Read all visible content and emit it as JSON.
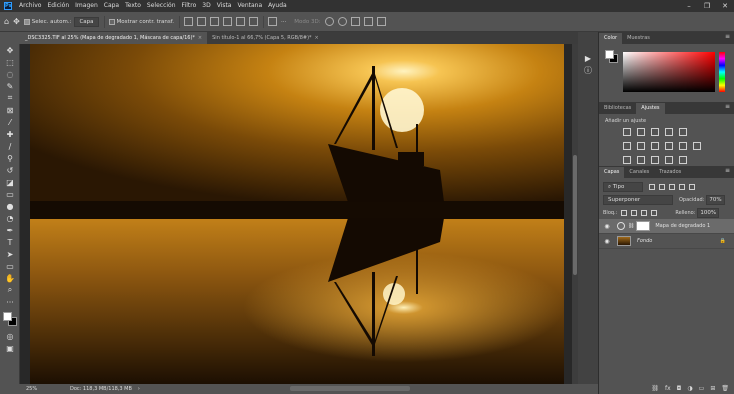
{
  "menubar": {
    "items": [
      "Archivo",
      "Edición",
      "Imagen",
      "Capa",
      "Texto",
      "Selección",
      "Filtro",
      "3D",
      "Vista",
      "Ventana",
      "Ayuda"
    ]
  },
  "options": {
    "auto_select_label": "Selec. autom.:",
    "auto_select_value": "Capa",
    "transform_label": "Mostrar contr. transf.",
    "mode3d_label": "Modo 3D:"
  },
  "tabs": [
    {
      "label": "_DSC3325.TIF al 25% (Mapa de degradado 1, Máscara de capa/16)*",
      "active": true
    },
    {
      "label": "Sin título-1 al 66,7% (Capa 5, RGB/8#)*",
      "active": false
    }
  ],
  "status": {
    "zoom": "25%",
    "doc": "Doc: 118,3 MB/118,3 MB"
  },
  "panels": {
    "color_tabs": [
      "Color",
      "Muestras"
    ],
    "adjust_tabs": [
      "Bibliotecas",
      "Ajustes"
    ],
    "adjust_hint": "Añadir un ajuste",
    "layers_tabs": [
      "Capas",
      "Canales",
      "Trazados"
    ],
    "filter_kind": "Tipo",
    "blend_mode": "Superponer",
    "opacity_label": "Opacidad:",
    "opacity_value": "70%",
    "lock_label": "Bloq.:",
    "fill_label": "Relleno:",
    "fill_value": "100%",
    "layers": [
      {
        "name": "Mapa de degradado 1",
        "selected": true
      },
      {
        "name": "Fondo",
        "selected": false
      }
    ]
  },
  "colors": {
    "accent": "#31a8ff",
    "ui_bg": "#535353",
    "menubar": "#323232"
  }
}
